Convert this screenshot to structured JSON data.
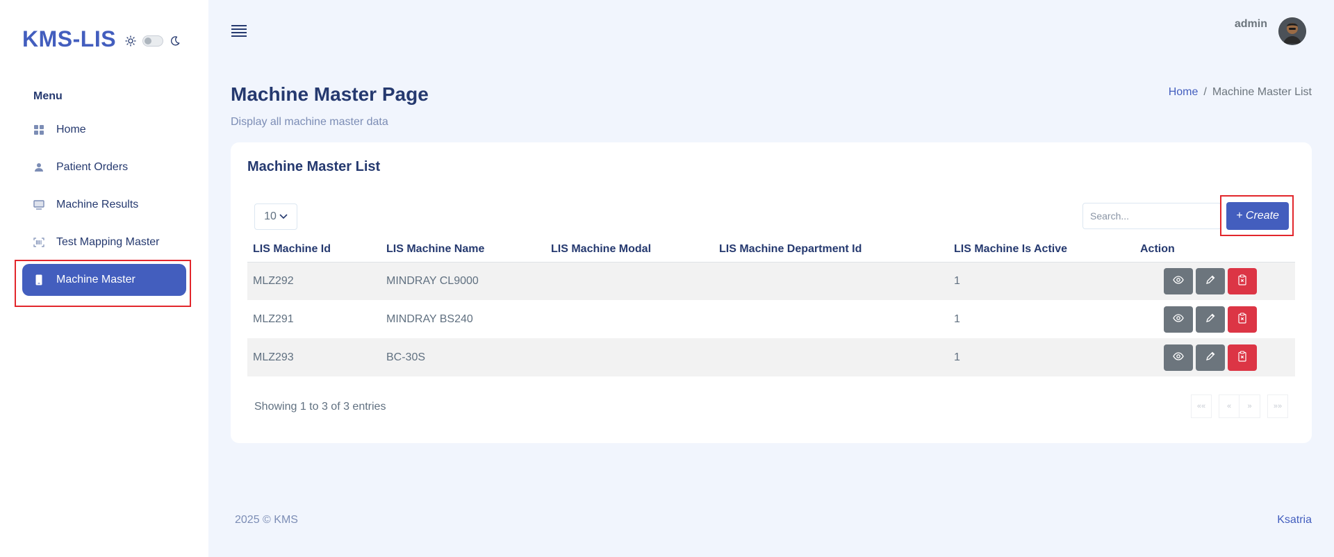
{
  "sidebar": {
    "brand": "KMS-LIS",
    "menu_title": "Menu",
    "items": [
      {
        "label": "Home",
        "icon": "grid-icon"
      },
      {
        "label": "Patient Orders",
        "icon": "person-icon"
      },
      {
        "label": "Machine Results",
        "icon": "monitor-icon"
      },
      {
        "label": "Test Mapping Master",
        "icon": "barcode-icon"
      },
      {
        "label": "Machine Master",
        "icon": "phone-icon",
        "active": true
      }
    ]
  },
  "topbar": {
    "user_name": "admin"
  },
  "page": {
    "title": "Machine Master Page",
    "subtitle": "Display all machine master data",
    "breadcrumb": {
      "home": "Home",
      "separator": "/",
      "current": "Machine Master List"
    }
  },
  "card": {
    "title": "Machine Master List",
    "page_size": "10",
    "search_placeholder": "Search...",
    "create_label": "+ Create",
    "columns": [
      "LIS Machine Id",
      "LIS Machine Name",
      "LIS Machine Modal",
      "LIS Machine Department Id",
      "LIS Machine Is Active",
      "Action"
    ],
    "rows": [
      {
        "id": "MLZ292",
        "name": "MINDRAY CL9000",
        "modal": "",
        "department_id": "",
        "is_active": "1"
      },
      {
        "id": "MLZ291",
        "name": "MINDRAY BS240",
        "modal": "",
        "department_id": "",
        "is_active": "1"
      },
      {
        "id": "MLZ293",
        "name": "BC-30S",
        "modal": "",
        "department_id": "",
        "is_active": "1"
      }
    ],
    "info": "Showing 1 to 3 of 3 entries",
    "pager": [
      "««",
      "«",
      "»",
      "»»"
    ]
  },
  "footer": {
    "left": "2025 © KMS",
    "right": "Ksatria"
  },
  "colors": {
    "primary": "#435ebe",
    "danger": "#dc3545",
    "secondary": "#6c757d",
    "highlight": "#e2262b"
  }
}
